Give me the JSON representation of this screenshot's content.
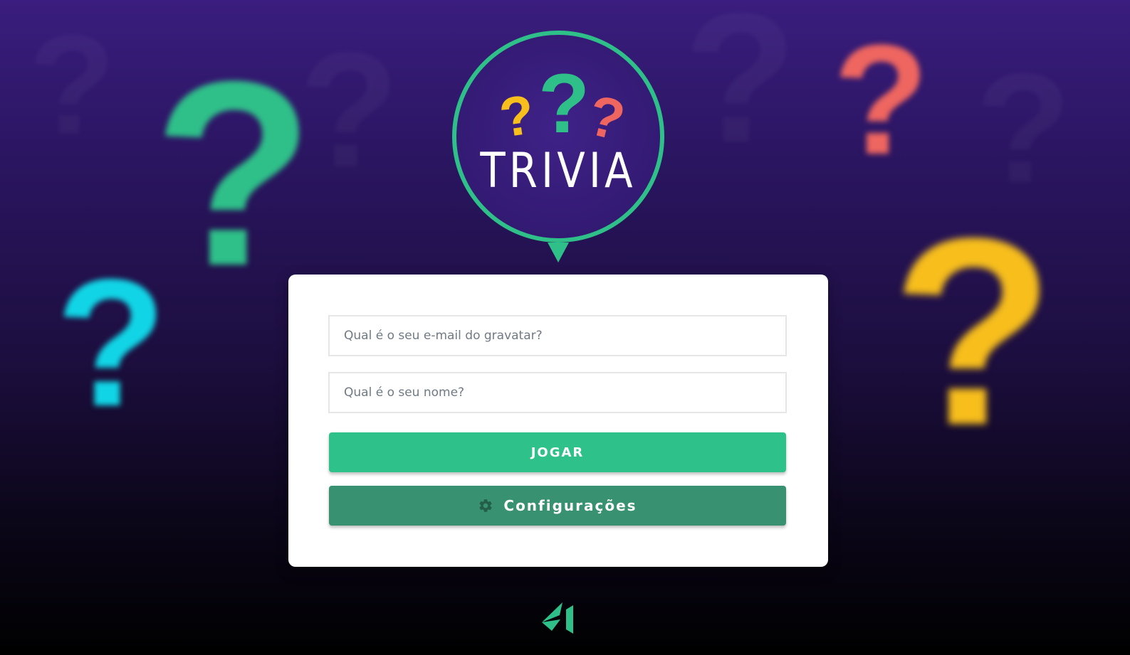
{
  "background": {
    "question_mark_glyph": "?",
    "colors": {
      "green": "#2fc089",
      "cyan": "#11d5e6",
      "red": "#ef6660",
      "yellow": "#f7be1c",
      "gradient_top": "#3a1d7e",
      "gradient_bottom": "#000000"
    }
  },
  "logo": {
    "title": "TRIVIA",
    "glyph": "?",
    "ring_color": "#2fc089",
    "fill_color": "#331a73"
  },
  "form": {
    "email_placeholder": "Qual é o seu e-mail do gravatar?",
    "email_value": "",
    "name_placeholder": "Qual é o seu nome?",
    "name_value": "",
    "play_label": "JOGAR",
    "settings_label": "Configurações",
    "settings_icon": "gear-icon",
    "play_color": "#2fc18a",
    "settings_color": "#389171"
  },
  "footer": {
    "logo_icon": "trybe-logo-icon",
    "logo_color": "#2fc089"
  }
}
